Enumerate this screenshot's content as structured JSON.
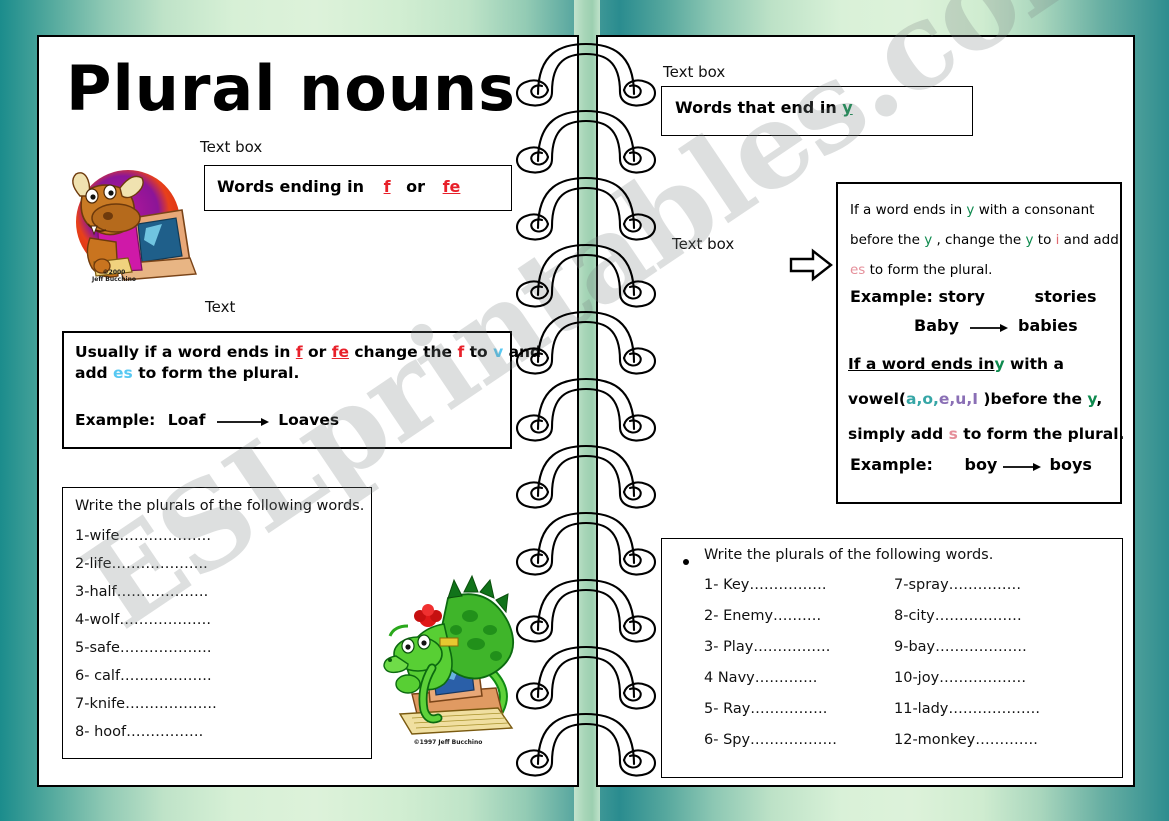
{
  "watermark": {
    "text": "ESLprintables.com"
  },
  "title": "Plural nouns",
  "left_page": {
    "textbox_label": "Text box",
    "textbox_line": {
      "pre": "Words ending in",
      "f": "f",
      "or": "or",
      "fe": "fe"
    },
    "clipart_bull": {
      "name": "bull-at-computer-clipart",
      "credit_line1": "©2000",
      "credit_line2": "Jeff Bucchino"
    },
    "text_label": "Text",
    "rule": {
      "l1_a": "Usually if a word ends in ",
      "l1_f": "f",
      "l1_b": " or ",
      "l1_fe": "fe",
      "l1_c": " change the ",
      "l1_f2": "f",
      "l1_d": " to ",
      "l1_v": "v",
      "l1_e": " and",
      "l2_a": "add ",
      "l2_es": "es",
      "l2_b": " to form the plural.",
      "example_label": "Example:",
      "example_from": "Loaf",
      "example_to": "Loaves"
    },
    "exercise": {
      "heading": "Write the plurals of the following words.",
      "items": [
        "1-wife……………….",
        "2-life………………..",
        "3-half……………….",
        "4-wolf……………….",
        "5-safe……………….",
        "6- calf……………….",
        "7-knife……………….",
        "8- hoof……………."
      ]
    },
    "clipart_dragon": {
      "name": "dragon-at-computer-clipart",
      "credit": "©1997 Jeff Bucchino"
    }
  },
  "right_page": {
    "textbox_label": "Text box",
    "textbox_line": {
      "pre": "Words that end in ",
      "y": "y"
    },
    "arrow_label": "Text box",
    "arrow": {
      "name": "block-arrow-right"
    },
    "rule": {
      "p1_l1_a": "If a word ends in ",
      "p1_l1_y": "y",
      "p1_l1_b": " with a consonant",
      "p1_l2_a": "before the ",
      "p1_l2_y": "y",
      "p1_l2_b": " , change the ",
      "p1_l2_y2": "y",
      "p1_l2_c": " to ",
      "p1_l2_i": "i",
      "p1_l2_d": " and add",
      "p1_l3_es": "es",
      "p1_l3_a": " to form the plural.",
      "ex1_label": "Example: story",
      "ex1_result": "stories",
      "ex2_from": "Baby",
      "ex2_to": "babies",
      "p2_l1_a": " If a word ends in",
      "p2_l1_y": "y",
      "p2_l1_b": " with a",
      "p2_l2_a": "vowel(",
      "p2_l2_vowels": [
        "a",
        "o",
        "e",
        "u",
        "I"
      ],
      "p2_l2_b": " )before the ",
      "p2_l2_y": "y",
      "p2_l2_c": ",",
      "p2_l3_a": "simply  add ",
      "p2_l3_s": "s",
      "p2_l3_b": " to form the plural.",
      "ex3_label": "Example:",
      "ex3_from": "boy",
      "ex3_to": "boys"
    },
    "exercise": {
      "heading": "Write the plurals of the following words.",
      "col1": [
        "1-  Key…………….",
        "2-  Enemy……….",
        "3-  Play…………….",
        "4   Navy………….",
        "5-  Ray…………….",
        "6-  Spy………………"
      ],
      "col2": [
        "7-spray……………",
        "8-city………………",
        "9-bay……………….",
        "10-joy………………",
        "11-lady……………….",
        " 12-monkey…………."
      ]
    }
  },
  "colors": {
    "red": "#e8202a",
    "blue": "#57c8f2",
    "green": "#0e8a4e",
    "pink": "#e58f9a",
    "teal": "#36a6a6",
    "purple": "#8a6fb5",
    "spine": "#a8d6b8"
  }
}
